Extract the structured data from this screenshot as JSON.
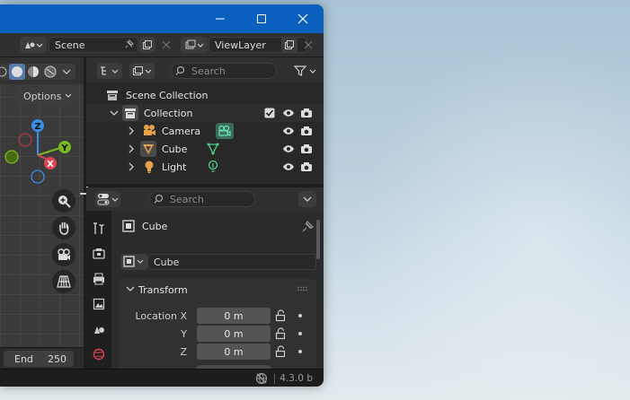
{
  "window": {
    "scene_name": "Scene",
    "view_layer_name": "ViewLayer"
  },
  "viewport": {
    "options_label": "Options",
    "gizmo_axes": [
      "Z",
      "Y",
      "X"
    ]
  },
  "timeline": {
    "end_label": "End",
    "end_value": "250"
  },
  "outliner": {
    "search_placeholder": "Search",
    "root_label": "Scene Collection",
    "collection_label": "Collection",
    "items": [
      {
        "label": "Camera",
        "icon": "camera-data-icon"
      },
      {
        "label": "Cube",
        "icon": "mesh-data-icon"
      },
      {
        "label": "Light",
        "icon": "light-data-icon"
      }
    ]
  },
  "properties": {
    "search_placeholder": "Search",
    "object_name": "Cube",
    "datablock_name": "Cube",
    "transform_label": "Transform",
    "location": {
      "x_label": "Location X",
      "x_value": "0 m",
      "y_label": "Y",
      "y_value": "0 m",
      "z_label": "Z",
      "z_value": "0 m"
    }
  },
  "status": {
    "version": "4.3.0 b"
  },
  "colors": {
    "title_bar": "#0a5fbf",
    "active_shading": "#dcdcdc",
    "gizmo_x": "#e0434f",
    "gizmo_y": "#7bb71f",
    "gizmo_z": "#3a8ee8",
    "object_data_green": "#4fcf8a"
  }
}
